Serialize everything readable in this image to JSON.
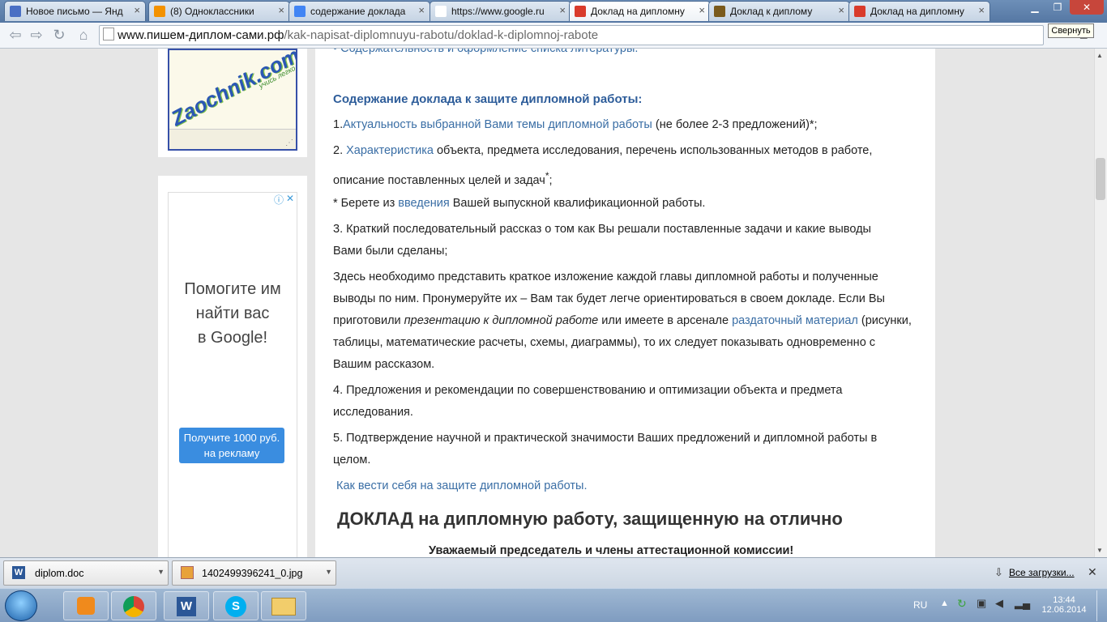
{
  "tabs": [
    {
      "title": "Новое письмо — Янд",
      "fav": "mail-icon",
      "color": "#4a6fc4"
    },
    {
      "title": "(8) Одноклассники",
      "fav": "odnoklassniki-icon",
      "color": "#f39200"
    },
    {
      "title": "содержание доклада",
      "fav": "google-icon",
      "color": "#4285f4"
    },
    {
      "title": "https://www.google.ru",
      "fav": "page-icon",
      "color": "#ffffff"
    },
    {
      "title": "Доклад на дипломну",
      "fav": "site-5plus-icon",
      "color": "#d93b2b"
    },
    {
      "title": "Доклад к диплому",
      "fav": "site-5-icon",
      "color": "#7a5a1c"
    },
    {
      "title": "Доклад на дипломну",
      "fav": "site-5plus-icon",
      "color": "#d93b2b"
    }
  ],
  "address": {
    "host": "www.пишем-диплом-сами.рф",
    "path": "/kak-napisat-diplomnuyu-rabotu/doklad-k-diplomnoj-rabote"
  },
  "tooltip": "Свернуть",
  "logo_text": "Zaochnik.com",
  "logo_sub": "учись легко",
  "ad": {
    "line1": "Помогите им",
    "line2": "найти вас",
    "line3": "в Google!",
    "button": "Получите 1000 руб. на рекламу"
  },
  "content": {
    "top_cut": "• Содержательность и оформление списка литературы.",
    "heading": "Содержание доклада к защите дипломной работы:",
    "p1_num": "1.",
    "p1_link": "Актуальность выбранной Вами темы дипломной работы",
    "p1_rest": " (не более 2-3 предложений)*;",
    "p2_num": "2. ",
    "p2_link": "Характеристика",
    "p2_rest": " объекта, предмета исследования, перечень использованных методов в работе,",
    "p2_line2": "описание поставленных целей и задач",
    "p2_sup": "*",
    "p2_end": ";",
    "note_start": "* Берете из ",
    "note_link": "введения",
    "note_end": " Вашей выпускной квалификационной работы.",
    "p3_line1": "3. Краткий последовательный рассказ о том как Вы решали поставленные задачи и какие выводы",
    "p3_line2": "Вами были сделаны;",
    "p4_line1": "Здесь необходимо представить краткое изложение каждой главы дипломной работы и полученные",
    "p4_line2": "выводы по ним. Пронумеруйте их – Вам так будет легче ориентироваться в своем докладе. Если Вы",
    "p4_line3_a": "приготовили ",
    "p4_line3_em": "презентацию к дипломной работе",
    "p4_line3_b": " или имеете в арсенале ",
    "p4_line3_link": "раздаточный материал",
    "p4_line3_c": " (рисунки,",
    "p4_line4": "таблицы, математические расчеты, схемы, диаграммы), то их следует показывать одновременно с",
    "p4_line5": "Вашим рассказом.",
    "p5_line1": "4. Предложения и рекомендации по совершенствованию и оптимизации объекта и предмета",
    "p5_line2": "исследования.",
    "p6_line1": "5. Подтверждение научной и практической значимости Ваших предложений и дипломной работы в",
    "p6_line2": "целом.",
    "behavior_link": "Как вести себя на защите дипломной работы.",
    "big_title": "ДОКЛАД на дипломную работу, защищенную на отлично",
    "greeting": "Уважаемый председатель и члены аттестационной комиссии!"
  },
  "downloads": {
    "item1": "diplom.doc",
    "item2": "1402499396241_0.jpg",
    "all": "Все загрузки..."
  },
  "taskbar": {
    "lang": "RU",
    "time": "13:44",
    "date": "12.06.2014"
  }
}
